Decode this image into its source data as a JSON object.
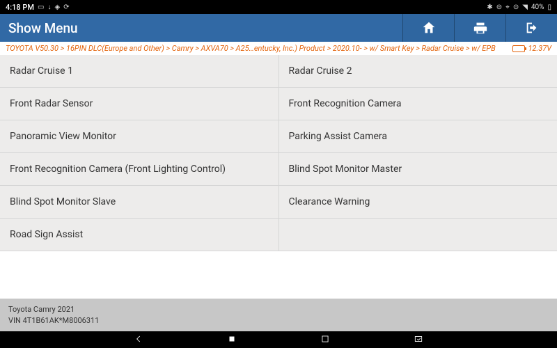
{
  "status": {
    "time": "4:18 PM",
    "battery_pct": "40%"
  },
  "toolbar": {
    "title": "Show Menu"
  },
  "breadcrumb": {
    "text": "TOYOTA V50.30 > 16PIN DLC(Europe and Other) > Camry > AXVA70 > A25…entucky, Inc.) Product > 2020.10- > w/ Smart Key > Radar Cruise > w/ EPB",
    "voltage": "12.37V"
  },
  "menu": {
    "rows": [
      {
        "left": "Radar Cruise 1",
        "right": "Radar Cruise 2"
      },
      {
        "left": "Front Radar Sensor",
        "right": "Front Recognition Camera"
      },
      {
        "left": "Panoramic View Monitor",
        "right": "Parking Assist Camera"
      },
      {
        "left": "Front Recognition Camera (Front Lighting Control)",
        "right": "Blind Spot Monitor Master"
      },
      {
        "left": "Blind Spot Monitor Slave",
        "right": "Clearance Warning"
      },
      {
        "left": "Road Sign Assist",
        "right": ""
      }
    ]
  },
  "footer": {
    "vehicle": "Toyota Camry 2021",
    "vin": "VIN 4T1B61AK*M8006311"
  }
}
